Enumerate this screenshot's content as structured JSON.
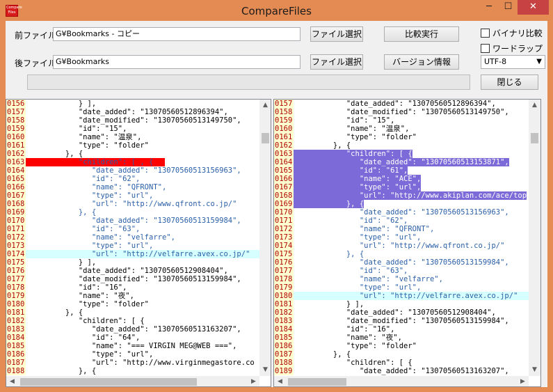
{
  "window": {
    "title": "CompareFiles",
    "icon_text": "Compare Files",
    "min_glyph": "─",
    "max_glyph": "☐",
    "close_glyph": "✕"
  },
  "controls": {
    "before_label": "前ファイル",
    "before_path": "G¥Bookmarks - コピー",
    "after_label": "後ファイル",
    "after_path": "G¥Bookmarks",
    "file_select_label": "ファイル選択",
    "compare_label": "比較実行",
    "version_label": "バージョン情報",
    "close_label": "閉じる",
    "binary_label": "バイナリ比較",
    "wordwrap_label": "ワードラップ",
    "encoding": "UTF-8",
    "encoding_arrow": "▼"
  },
  "left_lines": [
    {
      "n": "0156",
      "t": "            } ],"
    },
    {
      "n": "0157",
      "t": "            \"date_added\": \"13070560512896394\","
    },
    {
      "n": "0158",
      "t": "            \"date_modified\": \"13070560513149750\","
    },
    {
      "n": "0159",
      "t": "            \"id\": \"15\","
    },
    {
      "n": "0160",
      "t": "            \"name\": \"温泉\","
    },
    {
      "n": "0161",
      "t": "            \"type\": \"folder\""
    },
    {
      "n": "0162",
      "t": "         }, {"
    },
    {
      "n": "0163",
      "t": "            \"children\": [ , {",
      "hl": "red"
    },
    {
      "n": "0164",
      "t": "               \"date_added\": \"13070560513156963\",",
      "c": "blue"
    },
    {
      "n": "0165",
      "t": "               \"id\": \"62\",",
      "c": "blue"
    },
    {
      "n": "0166",
      "t": "               \"name\": \"QFRONT\",",
      "c": "blue"
    },
    {
      "n": "0167",
      "t": "               \"type\": \"url\",",
      "c": "blue"
    },
    {
      "n": "0168",
      "t": "               \"url\": \"http://www.qfront.co.jp/\"",
      "c": "blue"
    },
    {
      "n": "0169",
      "t": "            }, {",
      "c": "blue"
    },
    {
      "n": "0170",
      "t": "               \"date_added\": \"13070560513159984\",",
      "c": "blue"
    },
    {
      "n": "0171",
      "t": "               \"id\": \"63\",",
      "c": "blue"
    },
    {
      "n": "0172",
      "t": "               \"name\": \"velfarre\",",
      "c": "blue"
    },
    {
      "n": "0173",
      "t": "               \"type\": \"url\",",
      "c": "blue"
    },
    {
      "n": "0174",
      "t": "               \"url\": \"http://velfarre.avex.co.jp/\"",
      "c": "blue",
      "hl": "cyan"
    },
    {
      "n": "0175",
      "t": "            } ],"
    },
    {
      "n": "0176",
      "t": "            \"date_added\": \"13070560512908404\","
    },
    {
      "n": "0177",
      "t": "            \"date_modified\": \"13070560513159984\","
    },
    {
      "n": "0178",
      "t": "            \"id\": \"16\","
    },
    {
      "n": "0179",
      "t": "            \"name\": \"夜\","
    },
    {
      "n": "0180",
      "t": "            \"type\": \"folder\""
    },
    {
      "n": "0181",
      "t": "         }, {"
    },
    {
      "n": "0182",
      "t": "            \"children\": [ {"
    },
    {
      "n": "0183",
      "t": "               \"date_added\": \"13070560513163207\","
    },
    {
      "n": "0184",
      "t": "               \"id\": \"64\","
    },
    {
      "n": "0185",
      "t": "               \"name\": \"=== VIRGIN MEG@WEB ===\","
    },
    {
      "n": "0186",
      "t": "               \"type\": \"url\","
    },
    {
      "n": "0187",
      "t": "               \"url\": \"http://www.virginmegastore.co"
    },
    {
      "n": "0188",
      "t": "            }, {"
    }
  ],
  "right_lines": [
    {
      "n": "0157",
      "t": "            \"date_added\": \"13070560512896394\","
    },
    {
      "n": "0158",
      "t": "            \"date_modified\": \"13070560513149750\","
    },
    {
      "n": "0159",
      "t": "            \"id\": \"15\","
    },
    {
      "n": "0160",
      "t": "            \"name\": \"温泉\","
    },
    {
      "n": "0161",
      "t": "            \"type\": \"folder\""
    },
    {
      "n": "0162",
      "t": "         }, {"
    },
    {
      "n": "0163",
      "t": "            \"children\": [ {",
      "hl": "purple"
    },
    {
      "n": "0164",
      "t": "               \"date_added\": \"13070560513153871\",",
      "hl": "purple"
    },
    {
      "n": "0165",
      "t": "               \"id\": \"61\",",
      "hl": "purple"
    },
    {
      "n": "0166",
      "t": "               \"name\": \"ACE\",",
      "hl": "purple"
    },
    {
      "n": "0167",
      "t": "               \"type\": \"url\",",
      "hl": "purple"
    },
    {
      "n": "0168",
      "t": "               \"url\": \"http://www.akiplan.com/ace/top",
      "hl": "purple"
    },
    {
      "n": "0169",
      "t": "            }, {",
      "hl": "purple"
    },
    {
      "n": "0170",
      "t": "               \"date_added\": \"13070560513156963\",",
      "c": "blue"
    },
    {
      "n": "0171",
      "t": "               \"id\": \"62\",",
      "c": "blue"
    },
    {
      "n": "0172",
      "t": "               \"name\": \"QFRONT\",",
      "c": "blue"
    },
    {
      "n": "0173",
      "t": "               \"type\": \"url\",",
      "c": "blue"
    },
    {
      "n": "0174",
      "t": "               \"url\": \"http://www.qfront.co.jp/\"",
      "c": "blue"
    },
    {
      "n": "0175",
      "t": "            }, {",
      "c": "blue"
    },
    {
      "n": "0176",
      "t": "               \"date_added\": \"13070560513159984\",",
      "c": "blue"
    },
    {
      "n": "0177",
      "t": "               \"id\": \"63\",",
      "c": "blue"
    },
    {
      "n": "0178",
      "t": "               \"name\": \"velfarre\",",
      "c": "blue"
    },
    {
      "n": "0179",
      "t": "               \"type\": \"url\",",
      "c": "blue"
    },
    {
      "n": "0180",
      "t": "               \"url\": \"http://velfarre.avex.co.jp/\"",
      "c": "blue",
      "hl": "cyan"
    },
    {
      "n": "0181",
      "t": "            } ],"
    },
    {
      "n": "0182",
      "t": "            \"date_added\": \"13070560512908404\","
    },
    {
      "n": "0183",
      "t": "            \"date_modified\": \"13070560513159984\","
    },
    {
      "n": "0184",
      "t": "            \"id\": \"16\","
    },
    {
      "n": "0185",
      "t": "            \"name\": \"夜\","
    },
    {
      "n": "0186",
      "t": "            \"type\": \"folder\""
    },
    {
      "n": "0187",
      "t": "         }, {"
    },
    {
      "n": "0188",
      "t": "            \"children\": [ {"
    },
    {
      "n": "0189",
      "t": "               \"date_added\": \"13070560513163207\","
    }
  ],
  "scroll": {
    "up": "▲",
    "down": "▼",
    "left": "◀",
    "right": "▶"
  }
}
